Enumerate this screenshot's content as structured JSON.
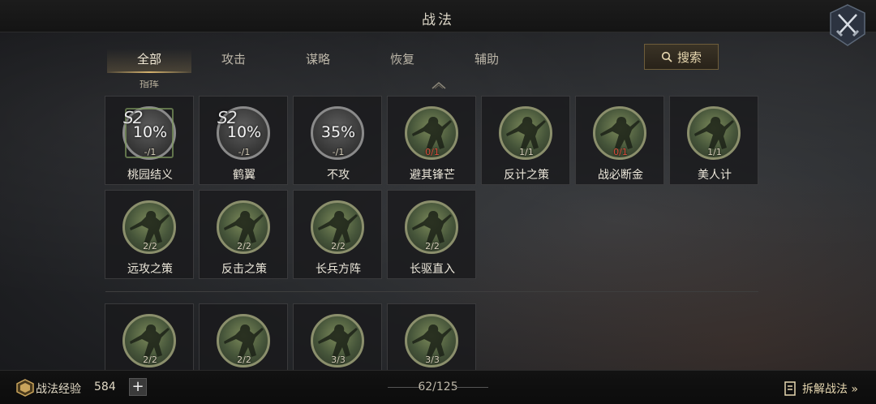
{
  "header": {
    "title": "战法"
  },
  "tabs": [
    {
      "label": "全部",
      "active": true
    },
    {
      "label": "攻击",
      "active": false
    },
    {
      "label": "谋略",
      "active": false
    },
    {
      "label": "恢复",
      "active": false
    },
    {
      "label": "辅助",
      "active": false
    }
  ],
  "search": {
    "label": "搜索",
    "icon": "search-icon"
  },
  "section": {
    "label": "指挥"
  },
  "skills_row1": [
    {
      "name": "桃园结义",
      "count": "-/1",
      "season": "S2",
      "percent": "10%",
      "locked": true
    },
    {
      "name": "鹤翼",
      "count": "-/1",
      "season": "S2",
      "percent": "10%",
      "locked": true
    },
    {
      "name": "不攻",
      "count": "-/1",
      "season": "",
      "percent": "35%",
      "locked": true
    },
    {
      "name": "避其锋芒",
      "count": "0/1",
      "count_color": "red"
    },
    {
      "name": "反计之策",
      "count": "1/1"
    },
    {
      "name": "战必断金",
      "count": "0/1",
      "count_color": "red"
    },
    {
      "name": "美人计",
      "count": "1/1"
    }
  ],
  "skills_row2": [
    {
      "name": "远攻之策",
      "count": "2/2"
    },
    {
      "name": "反击之策",
      "count": "2/2"
    },
    {
      "name": "长兵方阵",
      "count": "2/2"
    },
    {
      "name": "长驱直入",
      "count": "2/2"
    }
  ],
  "skills_row3": [
    {
      "count": "2/2"
    },
    {
      "count": "2/2"
    },
    {
      "count": "3/3"
    },
    {
      "count": "3/3"
    }
  ],
  "footer": {
    "exp_label": "战法经验",
    "exp_value": "584",
    "plus_label": "+",
    "page": "62/125",
    "decompose_label": "拆解战法 »"
  },
  "colors": {
    "accent": "#d4b26e",
    "red_count": "#d84b3a",
    "portrait_ring": "#8b8f6c"
  }
}
